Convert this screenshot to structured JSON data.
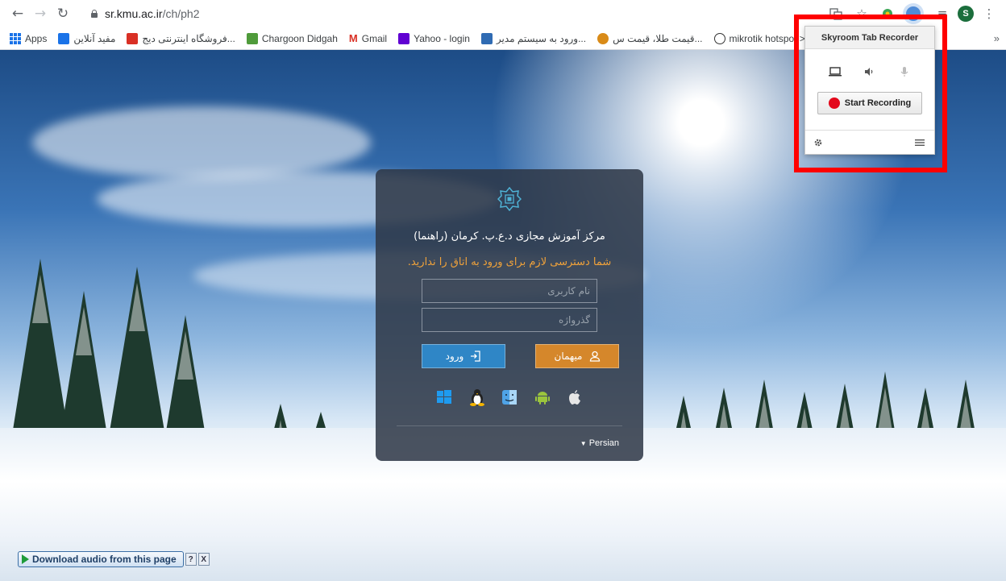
{
  "browser": {
    "url_host": "sr.kmu.ac.ir",
    "url_path": "/ch/ph2",
    "profile_initial": "S",
    "bookmarks": [
      {
        "label": "Apps",
        "color": "#1a73e8"
      },
      {
        "label": "مفید آنلاین",
        "color": "#1a73e8"
      },
      {
        "label": "فروشگاه اینترنتی دیج...",
        "color": "#d93025"
      },
      {
        "label": "Chargoon Didgah",
        "color": "#4f9b3b"
      },
      {
        "label": "Gmail",
        "color": "#d93025"
      },
      {
        "label": "Yahoo - login",
        "color": "#6001d2"
      },
      {
        "label": "ورود به سیستم مدیر...",
        "color": "#2f6bb3"
      },
      {
        "label": "قیمت طلا، قیمت س...",
        "color": "#d98b18"
      },
      {
        "label": "mikrotik hotspot >...",
        "color": "#333333"
      }
    ],
    "more_label": "»"
  },
  "login": {
    "title": "مرکز آموزش مجازی د.ع.پ. کرمان (راهنما)",
    "warning": "شما دسترسی لازم برای ورود به اتاق را ندارید.",
    "username_placeholder": "نام کاربری",
    "password_placeholder": "گذرواژه",
    "guest_label": "میهمان",
    "login_label": "ورود",
    "language": "Persian",
    "accent_guest": "#d5872b",
    "accent_login": "#2f86c6",
    "warning_color": "#f0a23a",
    "os_icons": [
      "windows-icon",
      "linux-icon",
      "mac-finder-icon",
      "android-icon",
      "apple-icon"
    ]
  },
  "extension": {
    "title": "Skyroom Tab Recorder",
    "record_label": "Start Recording",
    "record_color": "#e3081b",
    "highlight_color": "#ff0000"
  },
  "download_bar": {
    "label": "Download audio from this page",
    "help": "?",
    "close": "X"
  }
}
